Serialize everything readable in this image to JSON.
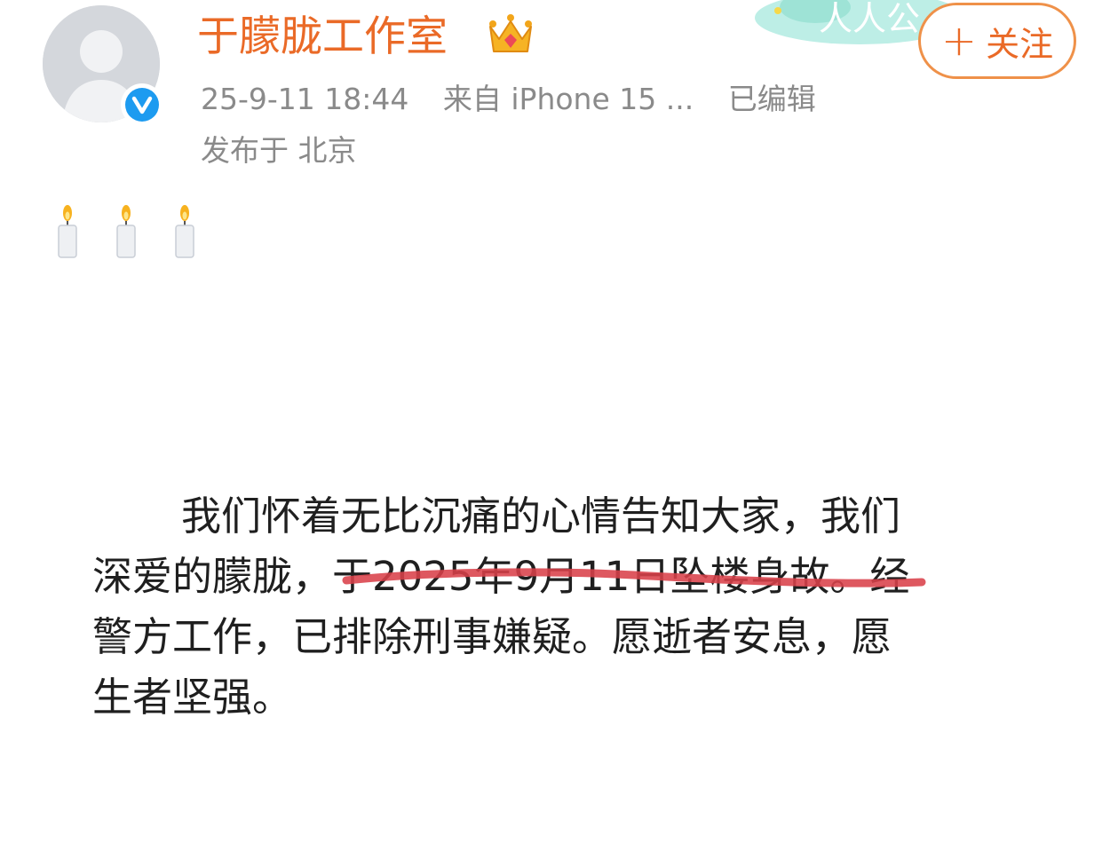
{
  "post": {
    "account_name": "于朦胧工作室",
    "follow_label": "关注",
    "timestamp": "25-9-11 18:44",
    "source": "来自 iPhone 15 ...",
    "edited": "已编辑",
    "location": "发布于 北京",
    "banner_text": "人人公",
    "candles": [
      "candle",
      "candle",
      "candle"
    ],
    "statement_lines": [
      "我们怀着无比沉痛的心情告知大家，我们",
      "深爱的朦胧，于2025年9月11日坠楼身故。经",
      "警方工作，已排除刑事嫌疑。愿逝者安息，愿",
      "生者坚强。"
    ]
  },
  "icons": {
    "avatar": "avatar-placeholder-icon",
    "verified": "verified-check-icon",
    "crown": "crown-icon",
    "follow": "plus-icon",
    "candle": "candle-icon"
  },
  "colors": {
    "brand_orange": "#ea6a27",
    "follow_border": "#ef9149",
    "meta_gray": "#8a8a8a",
    "body_text": "#1f1f1f",
    "verified_blue": "#1d9bf0",
    "highlight_red": "#d9414a"
  }
}
